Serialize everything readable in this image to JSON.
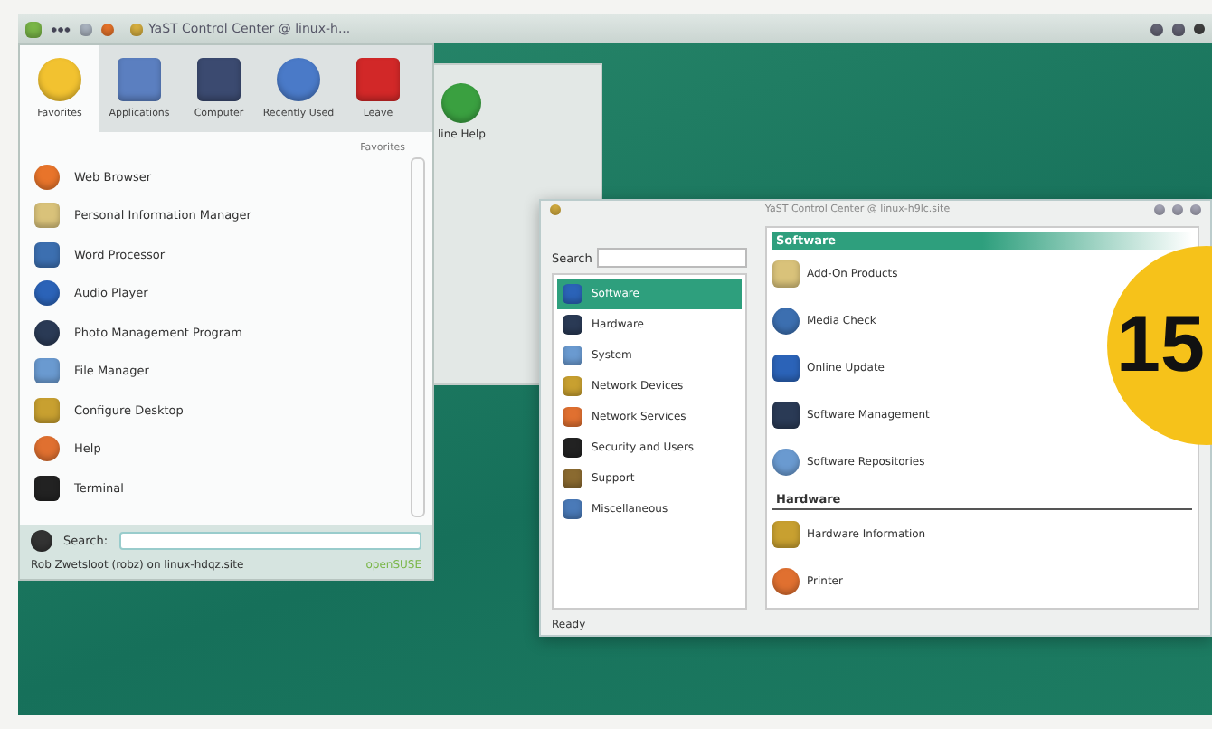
{
  "taskbar": {
    "window_title": "YaST Control Center @ linux-h..."
  },
  "desktop_icons": [
    {
      "label": "line Help"
    }
  ],
  "kickoff": {
    "tabs": [
      {
        "label": "Favorites",
        "selected": true
      },
      {
        "label": "Applications",
        "selected": false
      },
      {
        "label": "Computer",
        "selected": false
      },
      {
        "label": "Recently Used",
        "selected": false
      },
      {
        "label": "Leave",
        "selected": false
      }
    ],
    "heading": "Favorites",
    "items": [
      "Web Browser",
      "Personal Information Manager",
      "Word Processor",
      "Audio Player",
      "Photo Management Program",
      "File Manager",
      "Configure Desktop",
      "Help",
      "Terminal"
    ],
    "search_label": "Search:",
    "user_line": "Rob Zwetsloot (robz) on linux-hdqz.site",
    "brand": "openSUSE"
  },
  "yast": {
    "title": "YaST Control Center @ linux-h9lc.site",
    "search_label": "Search",
    "categories": [
      {
        "label": "Software",
        "selected": true
      },
      {
        "label": "Hardware",
        "selected": false
      },
      {
        "label": "System",
        "selected": false
      },
      {
        "label": "Network Devices",
        "selected": false
      },
      {
        "label": "Network Services",
        "selected": false
      },
      {
        "label": "Security and Users",
        "selected": false
      },
      {
        "label": "Support",
        "selected": false
      },
      {
        "label": "Miscellaneous",
        "selected": false
      }
    ],
    "sections": [
      {
        "title": "Software",
        "selected": true,
        "items": [
          "Add-On Products",
          "Media Check",
          "Online Update",
          "Software Management",
          "Software Repositories"
        ]
      },
      {
        "title": "Hardware",
        "selected": false,
        "items": [
          "Hardware Information",
          "Printer"
        ]
      }
    ],
    "status": "Ready"
  },
  "badge": {
    "text": "15"
  }
}
